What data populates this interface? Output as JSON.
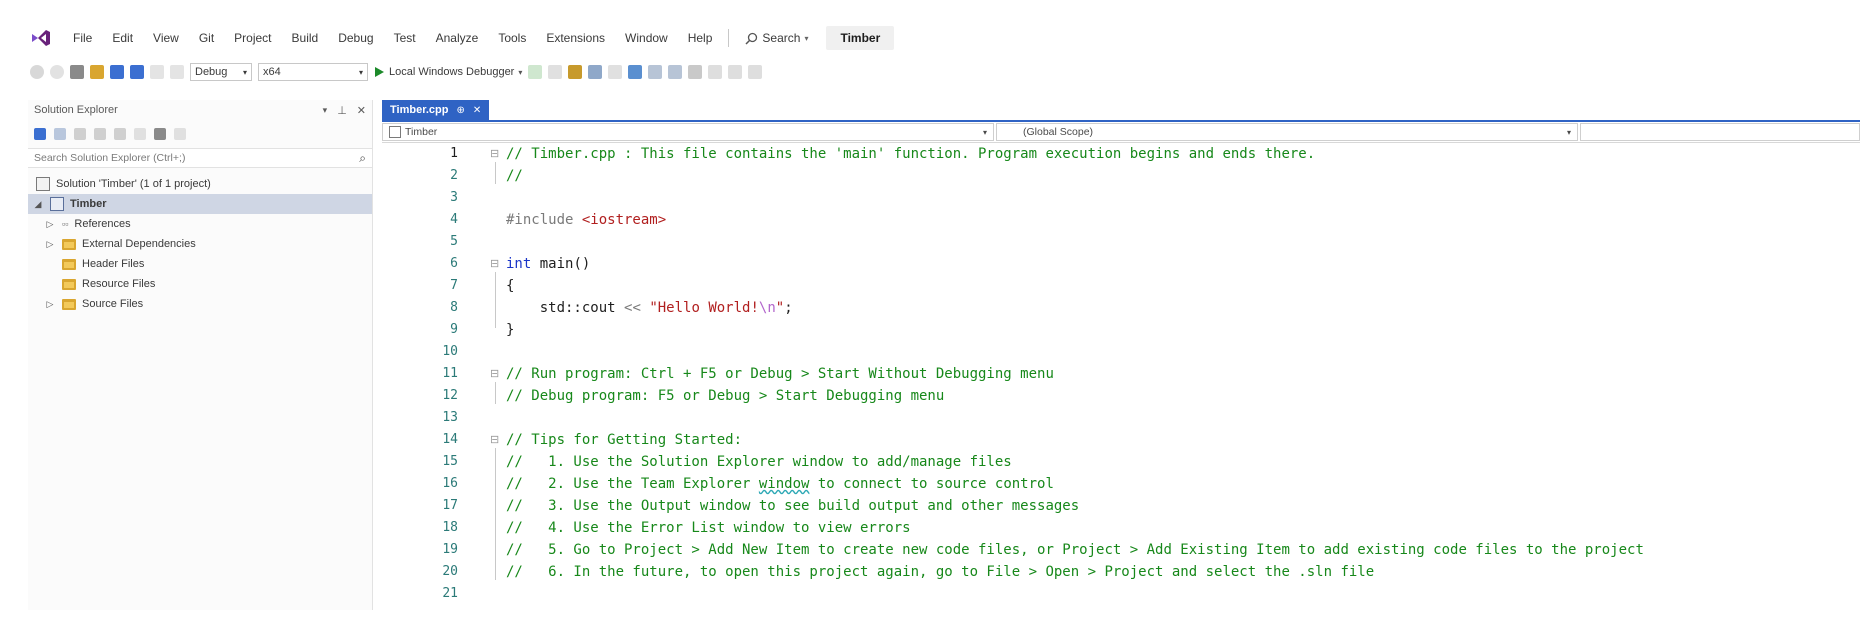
{
  "menu": {
    "items": [
      "File",
      "Edit",
      "View",
      "Git",
      "Project",
      "Build",
      "Debug",
      "Test",
      "Analyze",
      "Tools",
      "Extensions",
      "Window",
      "Help"
    ],
    "search_label": "Search",
    "solution_title": "Timber"
  },
  "toolbar": {
    "config": "Debug",
    "platform": "x64",
    "run_label": "Local Windows Debugger"
  },
  "solution_explorer": {
    "title": "Solution Explorer",
    "search_placeholder": "Search Solution Explorer (Ctrl+;)",
    "solution_node": "Solution 'Timber' (1 of 1 project)",
    "project_node": "Timber",
    "items": [
      "References",
      "External Dependencies",
      "Header Files",
      "Resource Files",
      "Source Files"
    ]
  },
  "editor": {
    "tab_name": "Timber.cpp",
    "tab_pin": "⊕",
    "tab_close": "✕",
    "nav_project": "Timber",
    "nav_scope": "(Global Scope)",
    "line_numbers": [
      "1",
      "2",
      "3",
      "4",
      "5",
      "6",
      "7",
      "8",
      "9",
      "10",
      "11",
      "12",
      "13",
      "14",
      "15",
      "16",
      "17",
      "18",
      "19",
      "20",
      "21"
    ],
    "code": {
      "l1": "// Timber.cpp : This file contains the 'main' function. Program execution begins and ends there.",
      "l2": "//",
      "l4_pre": "#include ",
      "l4_inc": "<iostream>",
      "l6_kw": "int",
      "l6_rest": " main()",
      "l7": "{",
      "l8_id": "    std::cout ",
      "l8_op": "<<",
      "l8_sp": " ",
      "l8_str1": "\"Hello World!",
      "l8_esc": "\\n",
      "l8_str2": "\"",
      "l8_end": ";",
      "l9": "}",
      "l11": "// Run program: Ctrl + F5 or Debug > Start Without Debugging menu",
      "l12": "// Debug program: F5 or Debug > Start Debugging menu",
      "l14": "// Tips for Getting Started:",
      "l15": "//   1. Use the Solution Explorer window to add/manage files",
      "l16a": "//   2. Use the Team Explorer ",
      "l16b": "window",
      "l16c": " to connect to source control",
      "l17": "//   3. Use the Output window to see build output and other messages",
      "l18": "//   4. Use the Error List window to view errors",
      "l19": "//   5. Go to Project > Add New Item to create new code files, or Project > Add Existing Item to add existing code files to the project",
      "l20": "//   6. In the future, to open this project again, go to File > Open > Project and select the .sln file"
    }
  }
}
